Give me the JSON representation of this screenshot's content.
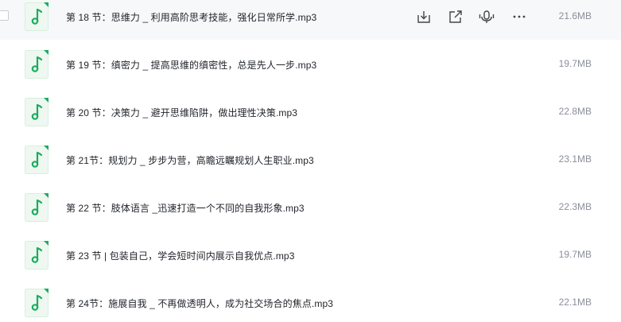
{
  "files": [
    {
      "name": "第 18 节：思维力 _ 利用高阶思考技能，强化日常所学.mp3",
      "size": "21.6MB"
    },
    {
      "name": "第 19 节：缜密力 _ 提高思维的缜密性，总是先人一步.mp3",
      "size": "19.7MB"
    },
    {
      "name": "第 20 节：决策力 _ 避开思维陷阱，做出理性决策.mp3",
      "size": "22.8MB"
    },
    {
      "name": "第 21节：规划力 _ 步步为营，高瞻远瞩规划人生职业.mp3",
      "size": "23.1MB"
    },
    {
      "name": "第 22 节：肢体语言 _迅速打造一个不同的自我形象.mp3",
      "size": "22.3MB"
    },
    {
      "name": "第 23 节 | 包装自己，学会短时间内展示自我优点.mp3",
      "size": "19.7MB"
    },
    {
      "name": "第 24节：施展自我 _ 不再做透明人，成为社交场合的焦点.mp3",
      "size": "22.1MB"
    }
  ],
  "row_actions": [
    "download-icon",
    "share-icon",
    "voice-icon",
    "more-icon"
  ],
  "colors": {
    "icon_green": "#1aad5c",
    "icon_bg": "#eef8f1",
    "text": "#1f2329",
    "size_text": "#8a8f99",
    "hover_bg": "#f7f8fa"
  }
}
